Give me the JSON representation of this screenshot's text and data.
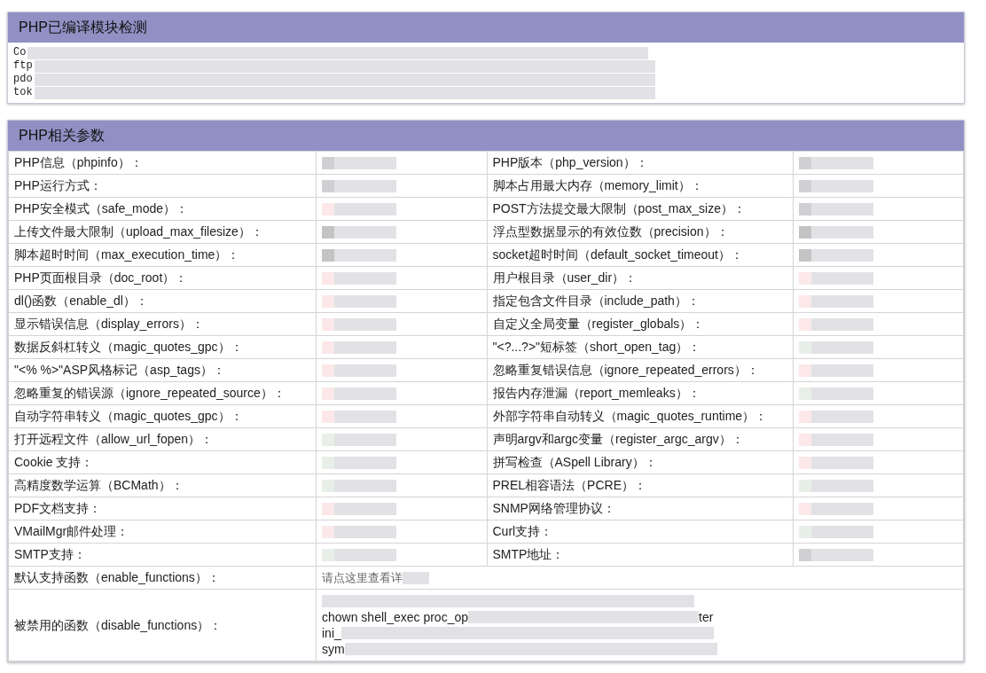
{
  "modules_panel": {
    "title": "PHP已编译模块检测",
    "lines": [
      "Co",
      "ftp",
      "pdo",
      "tok"
    ]
  },
  "params_panel": {
    "title": "PHP相关参数",
    "rows": [
      {
        "left": {
          "label": "PHP信息（phpinfo）：",
          "color": "#d0d0d4"
        },
        "right": {
          "label": "PHP版本（php_version）：",
          "color": "#d0d0d4"
        }
      },
      {
        "left": {
          "label": "PHP运行方式：",
          "color": "#d0d0d4"
        },
        "right": {
          "label": "脚本占用最大内存（memory_limit）：",
          "color": "#d0d0d4"
        }
      },
      {
        "left": {
          "label": "PHP安全模式（safe_mode）：",
          "color": "#fce8e8"
        },
        "right": {
          "label": "POST方法提交最大限制（post_max_size）：",
          "color": "#d0d0d4"
        }
      },
      {
        "left": {
          "label": "上传文件最大限制（upload_max_filesize）：",
          "color": "#c4c4c4"
        },
        "right": {
          "label": "浮点型数据显示的有效位数（precision）：",
          "color": "#c4c4c4"
        }
      },
      {
        "left": {
          "label": "脚本超时时间（max_execution_time）：",
          "color": "#c4c4c4"
        },
        "right": {
          "label": "socket超时时间（default_socket_timeout）：",
          "color": "#c4c4c4"
        }
      },
      {
        "left": {
          "label": "PHP页面根目录（doc_root）：",
          "color": "#fce8e8"
        },
        "right": {
          "label": "用户根目录（user_dir）：",
          "color": "#fce8e8"
        }
      },
      {
        "left": {
          "label": "dl()函数（enable_dl）：",
          "color": "#fce8e8"
        },
        "right": {
          "label": "指定包含文件目录（include_path）：",
          "color": "#fce8e8"
        }
      },
      {
        "left": {
          "label": "显示错误信息（display_errors）：",
          "color": "#fce8e8"
        },
        "right": {
          "label": "自定义全局变量（register_globals）：",
          "color": "#fce8e8"
        }
      },
      {
        "left": {
          "label": "数据反斜杠转义（magic_quotes_gpc）：",
          "color": "#fce8e8"
        },
        "right": {
          "label": "\"<?...?>\"短标签（short_open_tag）：",
          "color": "#e8efe8"
        }
      },
      {
        "left": {
          "label": "\"<% %>\"ASP风格标记（asp_tags）：",
          "color": "#fce8e8"
        },
        "right": {
          "label": "忽略重复错误信息（ignore_repeated_errors）：",
          "color": "#fce8e8"
        }
      },
      {
        "left": {
          "label": "忽略重复的错误源（ignore_repeated_source）：",
          "color": "#fce8e8"
        },
        "right": {
          "label": "报告内存泄漏（report_memleaks）：",
          "color": "#e8efe8"
        }
      },
      {
        "left": {
          "label": "自动字符串转义（magic_quotes_gpc）：",
          "color": "#fce8e8"
        },
        "right": {
          "label": "外部字符串自动转义（magic_quotes_runtime）：",
          "color": "#fce8e8"
        }
      },
      {
        "left": {
          "label": "打开远程文件（allow_url_fopen）：",
          "color": "#e8efe8"
        },
        "right": {
          "label": "声明argv和argc变量（register_argc_argv）：",
          "color": "#fce8e8"
        }
      },
      {
        "left": {
          "label": "Cookie 支持：",
          "color": "#e8efe8"
        },
        "right": {
          "label": "拼写检查（ASpell Library）：",
          "color": "#fce8e8"
        }
      },
      {
        "left": {
          "label": "高精度数学运算（BCMath）：",
          "color": "#e8efe8"
        },
        "right": {
          "label": "PREL相容语法（PCRE）：",
          "color": "#e8efe8"
        }
      },
      {
        "left": {
          "label": "PDF文档支持：",
          "color": "#fce8e8"
        },
        "right": {
          "label": "SNMP网络管理协议：",
          "color": "#fce8e8"
        }
      },
      {
        "left": {
          "label": "VMailMgr邮件处理：",
          "color": "#fce8e8"
        },
        "right": {
          "label": "Curl支持：",
          "color": "#e8efe8"
        }
      },
      {
        "left": {
          "label": "SMTP支持：",
          "color": "#e8efe8"
        },
        "right": {
          "label": "SMTP地址：",
          "color": "#d0d0d4"
        }
      }
    ],
    "enable_functions": {
      "label": "默认支持函数（enable_functions）：",
      "link": "请点这里查看详"
    },
    "disable_functions": {
      "label": "被禁用的函数（disable_functions）：",
      "lines": [
        "chown shell_exec proc_op",
        "ini_",
        "sym"
      ],
      "tail": "ter"
    }
  }
}
